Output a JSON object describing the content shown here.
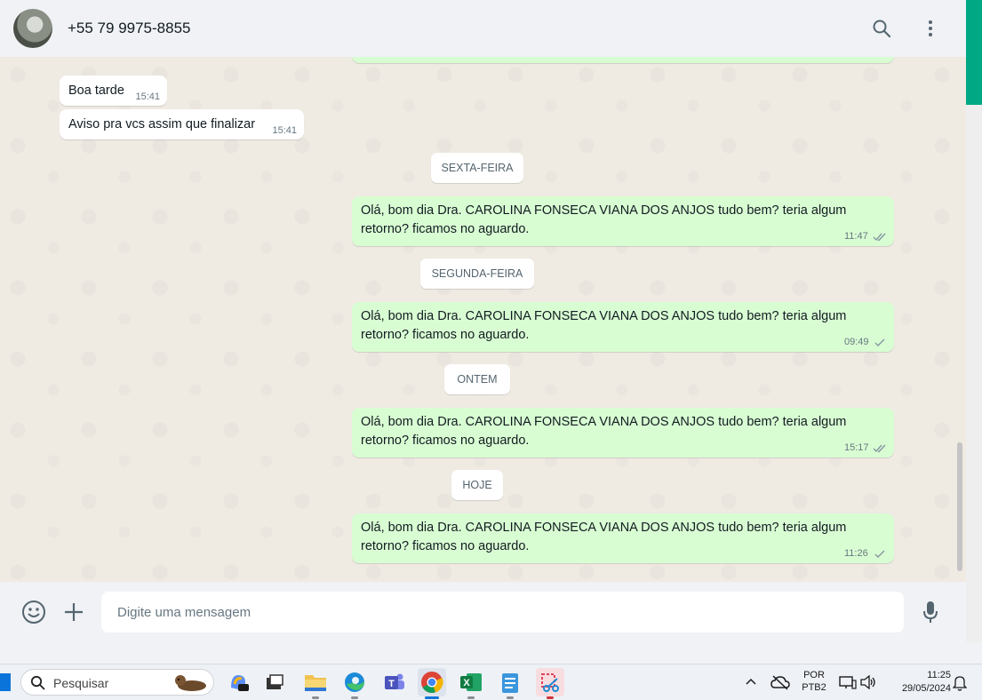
{
  "header": {
    "contact": "+55 79 9975-8855"
  },
  "messages_in": [
    {
      "text": "Boa tarde",
      "time": "15:41"
    },
    {
      "text": "Aviso pra vcs assim que finalizar",
      "time": "15:41"
    }
  ],
  "day_separators": [
    "SEXTA-FEIRA",
    "SEGUNDA-FEIRA",
    "ONTEM",
    "HOJE"
  ],
  "messages_out": [
    {
      "text": "Olá, bom dia Dra. CAROLINA FONSECA VIANA DOS ANJOS tudo bem? teria algum retorno? ficamos no aguardo.",
      "time": "11:47",
      "status": "double-check"
    },
    {
      "text": "Olá, bom dia Dra. CAROLINA FONSECA VIANA DOS ANJOS tudo bem? teria algum retorno? ficamos no aguardo.",
      "time": "09:49",
      "status": "single-check"
    },
    {
      "text": "Olá, bom dia Dra. CAROLINA FONSECA VIANA DOS ANJOS tudo bem? teria algum retorno? ficamos no aguardo.",
      "time": "15:17",
      "status": "double-check"
    },
    {
      "text": "Olá, bom dia Dra. CAROLINA FONSECA VIANA DOS ANJOS tudo bem? teria algum retorno? ficamos no aguardo.",
      "time": "11:26",
      "status": "single-check"
    }
  ],
  "composer": {
    "placeholder": "Digite uma mensagem"
  },
  "taskbar": {
    "search_label": "Pesquisar",
    "lang_top": "POR",
    "lang_bottom": "PTB2",
    "time": "11:25",
    "date": "29/05/2024",
    "apps": [
      "copilot-icon",
      "task-view-icon",
      "file-explorer-icon",
      "edge-icon",
      "teams-icon",
      "chrome-icon",
      "excel-icon",
      "notepad-icon",
      "snipping-tool-icon"
    ]
  },
  "colors": {
    "accent": "#00a884",
    "outgoing_bubble": "#d9fdd3",
    "incoming_bubble": "#ffffff",
    "chat_bg": "#efeae2"
  }
}
